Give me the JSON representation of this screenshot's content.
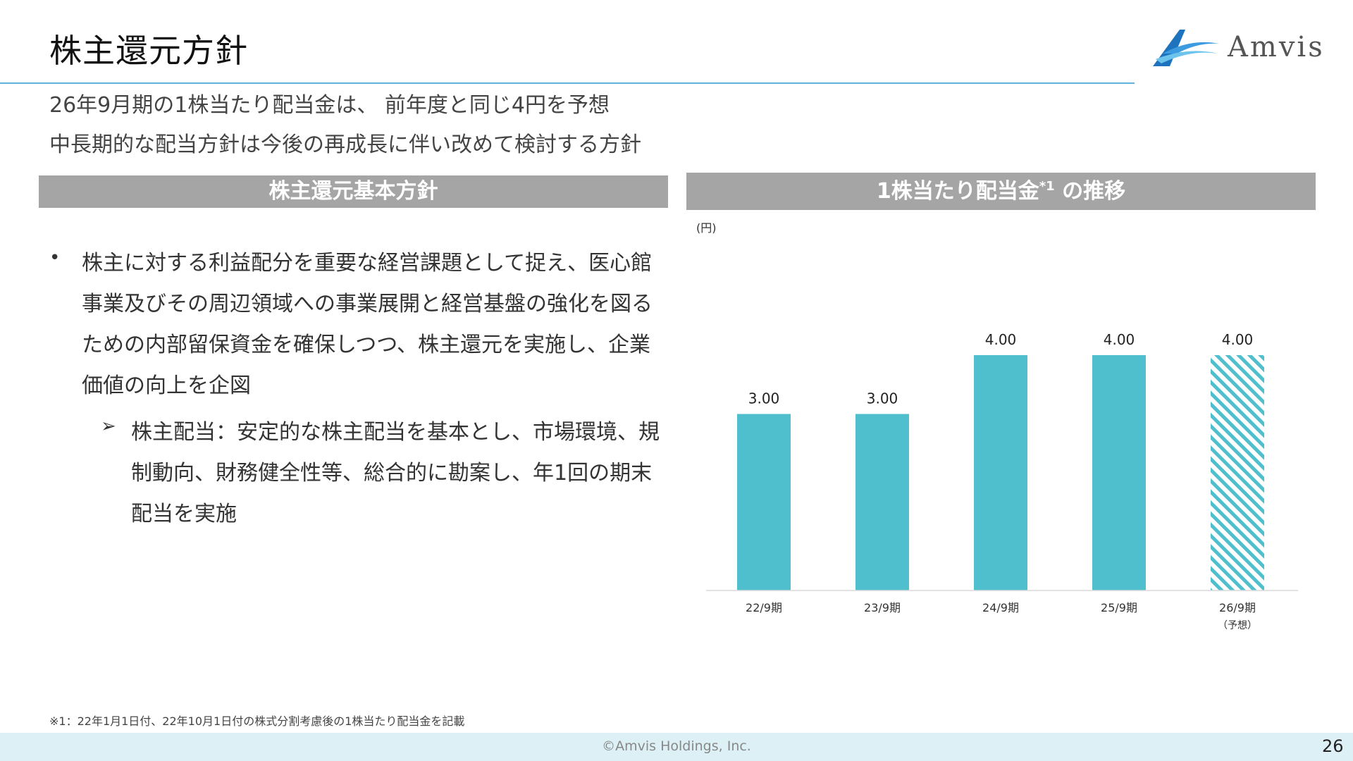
{
  "header": {
    "title": "株主還元方針",
    "logo_text": "Amvis"
  },
  "subtitle": {
    "line1": "26年9月期の1株当たり配当金は、 前年度と同じ4円を予想",
    "line2": "中長期的な配当方針は今後の再成長に伴い改めて検討する方針"
  },
  "left_panel": {
    "header": "株主還元基本方針",
    "bullet_symbol": "•",
    "bullet_text": "株主に対する利益配分を重要な経営課題として捉え、医心館事業及びその周辺領域への事業展開と経営基盤の強化を図るための内部留保資金を確保しつつ、株主還元を実施し、企業価値の向上を企図",
    "sub_symbol": "➢",
    "sub_text": "株主配当：安定的な株主配当を基本とし、市場環境、規制動向、財務健全性等、総合的に勘案し、年1回の期末配当を実施"
  },
  "right_panel": {
    "header_main": "1株当たり配当金",
    "header_sup": "*1",
    "header_tail": " の推移",
    "unit": "(円)"
  },
  "chart_data": {
    "type": "bar",
    "categories": [
      "22/9期",
      "23/9期",
      "24/9期",
      "25/9期",
      "26/9期"
    ],
    "category_notes": [
      "",
      "",
      "",
      "",
      "（予想）"
    ],
    "values": [
      3.0,
      3.0,
      4.0,
      4.0,
      4.0
    ],
    "value_labels": [
      "3.00",
      "3.00",
      "4.00",
      "4.00",
      "4.00"
    ],
    "forecast": [
      false,
      false,
      false,
      false,
      true
    ],
    "bar_color": "#4fbfce",
    "ylabel": "(円)",
    "ylim": [
      0,
      5
    ],
    "grid": false
  },
  "footer": {
    "footnote": "※1：22年1月1日付、22年10月1日付の株式分割考慮後の1株当たり配当金を記載",
    "copyright": "©Amvis Holdings, Inc.",
    "page_number": "26"
  },
  "colors": {
    "accent_rule": "#5fb5d8",
    "section_header_bg": "#a5a5a5",
    "footer_bg": "#dcf0f5",
    "logo_blue": "#1e73be"
  }
}
